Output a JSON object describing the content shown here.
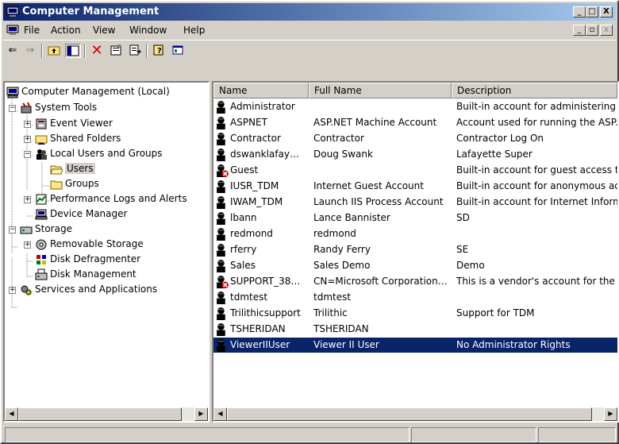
{
  "window": {
    "title": "Computer Management",
    "minimize": "_",
    "maximize": "□",
    "close": "X"
  },
  "menu": [
    "File",
    "Action",
    "View",
    "Window",
    "Help"
  ],
  "tree": [
    {
      "label": "Computer Management (Local)",
      "icon": "computer-icon"
    },
    {
      "label": "System Tools",
      "icon": "tools-icon",
      "expander": "−"
    },
    {
      "label": "Event Viewer",
      "icon": "event-viewer-icon",
      "expander": "+"
    },
    {
      "label": "Shared Folders",
      "icon": "shared-folder-icon",
      "expander": "+"
    },
    {
      "label": "Local Users and Groups",
      "icon": "users-groups-icon",
      "expander": "−"
    },
    {
      "label": "Users",
      "icon": "folder-open-icon"
    },
    {
      "label": "Groups",
      "icon": "folder-icon"
    },
    {
      "label": "Performance Logs and Alerts",
      "icon": "performance-icon",
      "expander": "+"
    },
    {
      "label": "Device Manager",
      "icon": "device-manager-icon"
    },
    {
      "label": "Storage",
      "icon": "storage-icon",
      "expander": "−"
    },
    {
      "label": "Removable Storage",
      "icon": "removable-storage-icon",
      "expander": "+"
    },
    {
      "label": "Disk Defragmenter",
      "icon": "defrag-icon"
    },
    {
      "label": "Disk Management",
      "icon": "disk-management-icon"
    },
    {
      "label": "Services and Applications",
      "icon": "services-icon",
      "expander": "+"
    }
  ],
  "columns": [
    "Name",
    "Full Name",
    "Description"
  ],
  "users": [
    {
      "name": "Administrator",
      "full": "",
      "desc": "Built-in account for administering th",
      "disabled": false
    },
    {
      "name": "ASPNET",
      "full": "ASP.NET Machine Account",
      "desc": "Account used for running the ASP.I",
      "disabled": false
    },
    {
      "name": "Contractor",
      "full": "Contractor",
      "desc": "Contractor Log On",
      "disabled": false
    },
    {
      "name": "dswanklafay…",
      "full": "Doug Swank",
      "desc": "Lafayette Super",
      "disabled": false
    },
    {
      "name": "Guest",
      "full": "",
      "desc": "Built-in account for guest access to",
      "disabled": true
    },
    {
      "name": "IUSR_TDM",
      "full": "Internet Guest Account",
      "desc": "Built-in account for anonymous acc",
      "disabled": false
    },
    {
      "name": "IWAM_TDM",
      "full": "Launch IIS Process Account",
      "desc": "Built-in account for Internet Inform",
      "disabled": false
    },
    {
      "name": "lbann",
      "full": "Lance Bannister",
      "desc": "SD",
      "disabled": false
    },
    {
      "name": "redmond",
      "full": "redmond",
      "desc": "",
      "disabled": false
    },
    {
      "name": "rferry",
      "full": "Randy Ferry",
      "desc": "SE",
      "disabled": false
    },
    {
      "name": "Sales",
      "full": "Sales Demo",
      "desc": "Demo",
      "disabled": false
    },
    {
      "name": "SUPPORT_38…",
      "full": "CN=Microsoft Corporation…",
      "desc": "This is a vendor's account for the H",
      "disabled": true
    },
    {
      "name": "tdmtest",
      "full": "tdmtest",
      "desc": "",
      "disabled": false
    },
    {
      "name": "Trilithicsupport",
      "full": "Trilithic",
      "desc": "Support for TDM",
      "disabled": false
    },
    {
      "name": "TSHERIDAN",
      "full": "TSHERIDAN",
      "desc": "",
      "disabled": false
    },
    {
      "name": "ViewerIIUser",
      "full": "Viewer II User",
      "desc": "No Administrator Rights",
      "disabled": false,
      "selected": true
    }
  ],
  "colors": {
    "selection": "#0a246a",
    "title_start": "#0a246a",
    "title_end": "#a6caf0"
  }
}
